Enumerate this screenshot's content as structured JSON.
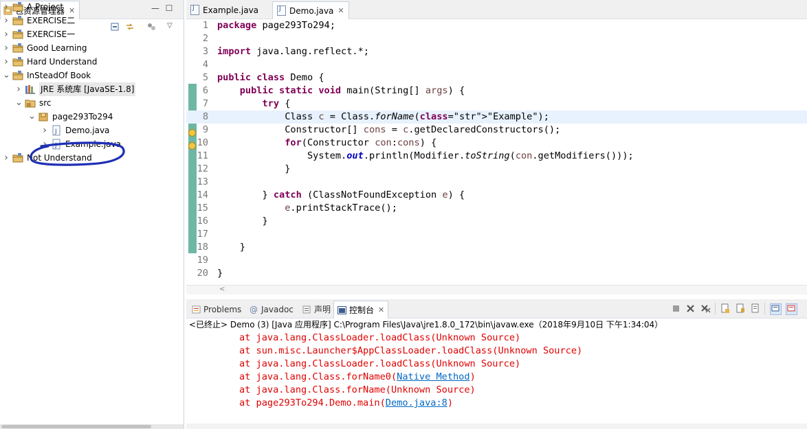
{
  "explorer": {
    "tab_label": "包资源管理器",
    "tree": [
      {
        "label": "A Project",
        "icon": "project-folder-icon",
        "depth": 0,
        "expanded": false
      },
      {
        "label": "EXERCISE二",
        "icon": "project-folder-icon",
        "depth": 0,
        "expanded": false
      },
      {
        "label": "EXERCISE一",
        "icon": "project-folder-icon",
        "depth": 0,
        "expanded": false
      },
      {
        "label": "Good Learning",
        "icon": "project-folder-icon",
        "depth": 0,
        "expanded": false
      },
      {
        "label": "Hard Understand",
        "icon": "project-folder-icon",
        "depth": 0,
        "expanded": false
      },
      {
        "label": "InSteadOf Book",
        "icon": "project-folder-icon",
        "depth": 0,
        "expanded": true
      },
      {
        "label": "JRE 系统库 [JavaSE-1.8]",
        "icon": "library-icon",
        "depth": 1,
        "expanded": false
      },
      {
        "label": "src",
        "icon": "source-folder-icon",
        "depth": 1,
        "expanded": true
      },
      {
        "label": "page293To294",
        "icon": "package-icon",
        "depth": 2,
        "expanded": true
      },
      {
        "label": "Demo.java",
        "icon": "java-file-icon",
        "depth": 3,
        "expanded": false
      },
      {
        "label": "Example.java",
        "icon": "java-file-icon",
        "depth": 3,
        "expanded": false
      },
      {
        "label": "Not Understand",
        "icon": "project-folder-icon",
        "depth": 0,
        "expanded": false
      }
    ]
  },
  "editor": {
    "tabs": [
      {
        "label": "Example.java",
        "active": false
      },
      {
        "label": "Demo.java",
        "active": true
      }
    ],
    "current_line": 8,
    "lines": [
      {
        "n": "1",
        "text": "package page293To294;"
      },
      {
        "n": "2",
        "text": ""
      },
      {
        "n": "3",
        "text": "import java.lang.reflect.*;"
      },
      {
        "n": "4",
        "text": ""
      },
      {
        "n": "5",
        "text": "public class Demo {"
      },
      {
        "n": "6",
        "text": "    public static void main(String[] args) {"
      },
      {
        "n": "7",
        "text": "        try {"
      },
      {
        "n": "8",
        "text": "            Class c = Class.forName(\"Example\");"
      },
      {
        "n": "9",
        "text": "            Constructor[] cons = c.getDeclaredConstructors();"
      },
      {
        "n": "10",
        "text": "            for(Constructor con:cons) {"
      },
      {
        "n": "11",
        "text": "                System.out.println(Modifier.toString(con.getModifiers()));"
      },
      {
        "n": "12",
        "text": "            }"
      },
      {
        "n": "13",
        "text": ""
      },
      {
        "n": "14",
        "text": "        } catch (ClassNotFoundException e) {"
      },
      {
        "n": "15",
        "text": "            e.printStackTrace();"
      },
      {
        "n": "16",
        "text": "        }"
      },
      {
        "n": "17",
        "text": ""
      },
      {
        "n": "18",
        "text": "    }"
      },
      {
        "n": "19",
        "text": ""
      },
      {
        "n": "20",
        "text": "}"
      }
    ]
  },
  "console": {
    "tabs": [
      {
        "label": "Problems",
        "active": false
      },
      {
        "label": "Javadoc",
        "active": false
      },
      {
        "label": "声明",
        "active": false
      },
      {
        "label": "控制台",
        "active": true
      }
    ],
    "description": "<已终止> Demo (3) [Java 应用程序] C:\\Program Files\\Java\\jre1.8.0_172\\bin\\javaw.exe（2018年9月10日 下午1:34:04）",
    "lines": [
      {
        "pre": "at java.lang.ClassLoader.loadClass(Unknown Source)",
        "link": "",
        "post": ""
      },
      {
        "pre": "at sun.misc.Launcher$AppClassLoader.loadClass(Unknown Source)",
        "link": "",
        "post": ""
      },
      {
        "pre": "at java.lang.ClassLoader.loadClass(Unknown Source)",
        "link": "",
        "post": ""
      },
      {
        "pre": "at java.lang.Class.forName0(",
        "link": "Native Method",
        "post": ")"
      },
      {
        "pre": "at java.lang.Class.forName(Unknown Source)",
        "link": "",
        "post": ""
      },
      {
        "pre": "at page293To294.Demo.main(",
        "link": "Demo.java:8",
        "post": ")"
      }
    ]
  },
  "colors": {
    "keyword": "#7f0055",
    "string": "#2a00ff",
    "field": "#0000c0",
    "console_error": "#e00000",
    "link": "#0068c5",
    "annotation_circle": "#1f2fb5"
  }
}
